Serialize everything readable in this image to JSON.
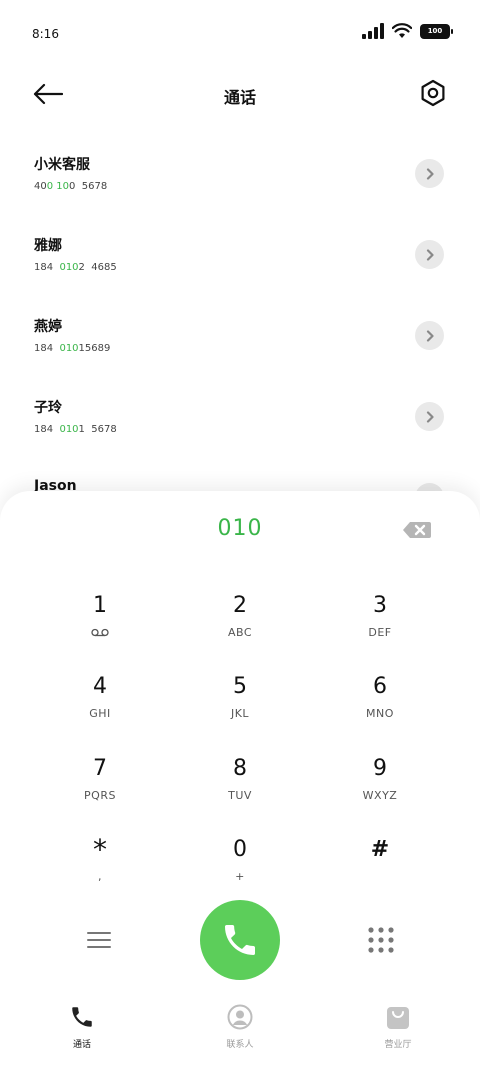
{
  "status": {
    "time": "8:16",
    "battery": "100"
  },
  "header": {
    "title": "通话"
  },
  "contacts": [
    {
      "name": "小米客服",
      "number_parts": [
        "40",
        "0",
        " ",
        "10",
        "0",
        "  5678"
      ]
    },
    {
      "name": "雅娜",
      "number_parts": [
        "184  ",
        "010",
        "2  4685"
      ]
    },
    {
      "name": "燕婷",
      "number_parts": [
        "184  ",
        "010",
        "15689"
      ]
    },
    {
      "name": "子玲",
      "number_parts": [
        "184  ",
        "010",
        "1  5678"
      ]
    },
    {
      "name": "Jason",
      "number_parts": []
    }
  ],
  "dialer": {
    "input": "010",
    "keys": [
      {
        "digit": "1",
        "letters": ""
      },
      {
        "digit": "2",
        "letters": "ABC"
      },
      {
        "digit": "3",
        "letters": "DEF"
      },
      {
        "digit": "4",
        "letters": "GHI"
      },
      {
        "digit": "5",
        "letters": "JKL"
      },
      {
        "digit": "6",
        "letters": "MNO"
      },
      {
        "digit": "7",
        "letters": "PQRS"
      },
      {
        "digit": "8",
        "letters": "TUV"
      },
      {
        "digit": "9",
        "letters": "WXYZ"
      },
      {
        "digit": "*",
        "letters": ","
      },
      {
        "digit": "0",
        "letters": "+"
      },
      {
        "digit": "#",
        "letters": ""
      }
    ]
  },
  "tabs": [
    {
      "label": "通话",
      "icon": "phone-icon",
      "active": true
    },
    {
      "label": "联系人",
      "icon": "contacts-icon",
      "active": false
    },
    {
      "label": "营业厅",
      "icon": "store-bag-icon",
      "active": false
    }
  ],
  "colors": {
    "accent": "#3ab549",
    "call_button": "#5cce5a"
  }
}
